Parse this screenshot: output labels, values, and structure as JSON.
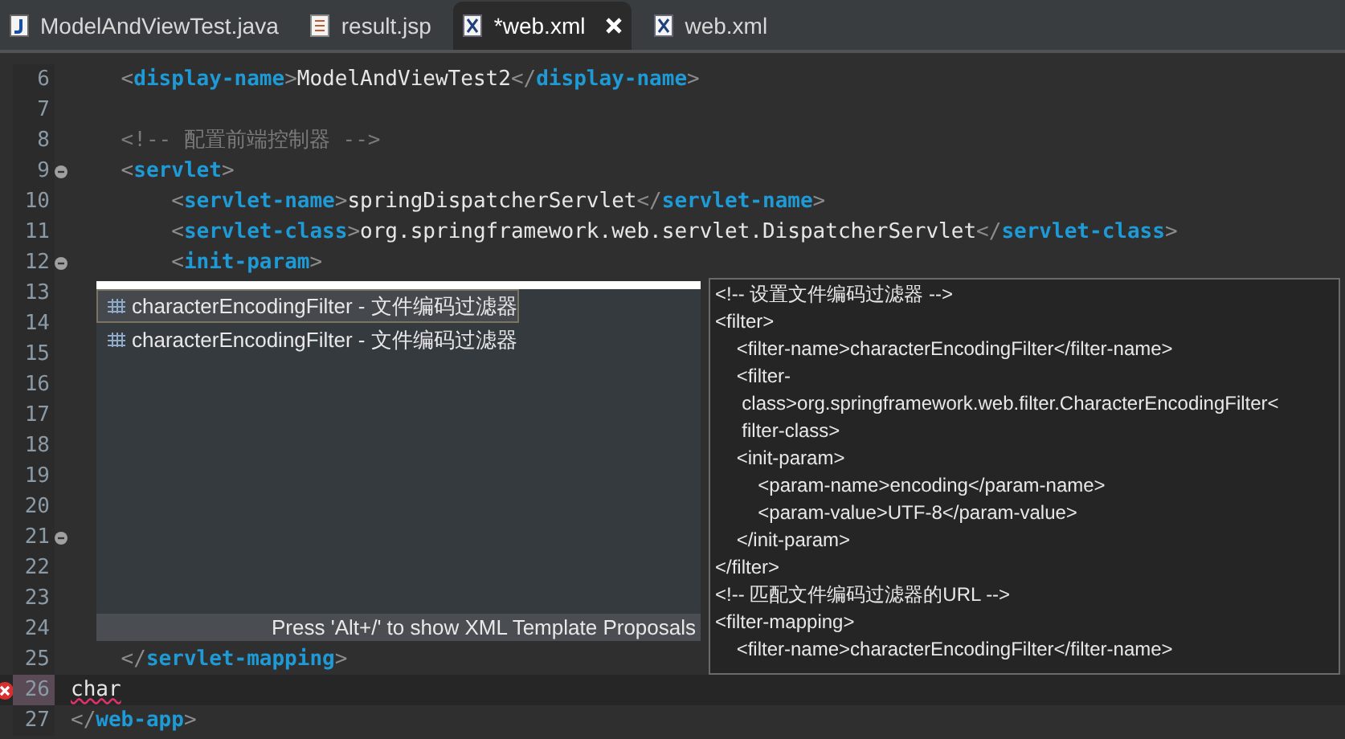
{
  "tabs": [
    {
      "label": "ModelAndViewTest.java",
      "kind": "java",
      "selected": false
    },
    {
      "label": "result.jsp",
      "kind": "jsp",
      "selected": false
    },
    {
      "label": "*web.xml",
      "kind": "xml",
      "selected": true
    },
    {
      "label": "web.xml",
      "kind": "xml",
      "selected": false
    }
  ],
  "editor": {
    "lines": [
      {
        "number": "6",
        "tokens": [
          {
            "kind": "bracket",
            "text": "    <"
          },
          {
            "kind": "tag",
            "text": "display-name"
          },
          {
            "kind": "bracket",
            "text": ">"
          },
          {
            "kind": "text",
            "text": "ModelAndViewTest2"
          },
          {
            "kind": "bracket",
            "text": "</"
          },
          {
            "kind": "tag",
            "text": "display-name"
          },
          {
            "kind": "bracket",
            "text": ">"
          }
        ]
      },
      {
        "number": "7"
      },
      {
        "number": "8",
        "tokens": [
          {
            "kind": "comment",
            "text": "    <!-- 配置前端控制器 -->"
          }
        ]
      },
      {
        "number": "9",
        "folding": true,
        "tokens": [
          {
            "kind": "bracket",
            "text": "    <"
          },
          {
            "kind": "tag",
            "text": "servlet"
          },
          {
            "kind": "bracket",
            "text": ">"
          }
        ]
      },
      {
        "number": "10",
        "tokens": [
          {
            "kind": "bracket",
            "text": "        <"
          },
          {
            "kind": "tag",
            "text": "servlet-name"
          },
          {
            "kind": "bracket",
            "text": ">"
          },
          {
            "kind": "text",
            "text": "springDispatcherServlet"
          },
          {
            "kind": "bracket",
            "text": "</"
          },
          {
            "kind": "tag",
            "text": "servlet-name"
          },
          {
            "kind": "bracket",
            "text": ">"
          }
        ]
      },
      {
        "number": "11",
        "tokens": [
          {
            "kind": "bracket",
            "text": "        <"
          },
          {
            "kind": "tag",
            "text": "servlet-class"
          },
          {
            "kind": "bracket",
            "text": ">"
          },
          {
            "kind": "text",
            "text": "org.springframework.web.servlet.DispatcherServlet"
          },
          {
            "kind": "bracket",
            "text": "</"
          },
          {
            "kind": "tag",
            "text": "servlet-class"
          },
          {
            "kind": "bracket",
            "text": ">"
          }
        ]
      },
      {
        "number": "12",
        "folding": true,
        "tokens": [
          {
            "kind": "bracket",
            "text": "        <"
          },
          {
            "kind": "tag",
            "text": "init-param"
          },
          {
            "kind": "bracket",
            "text": ">"
          }
        ]
      },
      {
        "number": "13"
      },
      {
        "number": "14"
      },
      {
        "number": "15"
      },
      {
        "number": "16"
      },
      {
        "number": "17"
      },
      {
        "number": "18"
      },
      {
        "number": "19"
      },
      {
        "number": "20"
      },
      {
        "number": "21",
        "folding": true
      },
      {
        "number": "22"
      },
      {
        "number": "23"
      },
      {
        "number": "24"
      },
      {
        "number": "25",
        "tokens": [
          {
            "kind": "bracket",
            "text": "    </"
          },
          {
            "kind": "tag",
            "text": "servlet-mapping"
          },
          {
            "kind": "bracket",
            "text": ">"
          }
        ]
      },
      {
        "number": "26",
        "current": true,
        "error": true,
        "tokens": [
          {
            "kind": "text",
            "text": "char"
          }
        ]
      },
      {
        "number": "27",
        "tokens": [
          {
            "kind": "bracket",
            "text": "</"
          },
          {
            "kind": "tag",
            "text": "web-app"
          },
          {
            "kind": "bracket",
            "text": ">"
          }
        ]
      }
    ]
  },
  "completion": {
    "items": [
      {
        "label": "characterEncodingFilter - 文件编码过滤器",
        "selected": true
      },
      {
        "label": "characterEncodingFilter - 文件编码过滤器",
        "selected": false
      }
    ],
    "status": "Press 'Alt+/' to show XML Template Proposals"
  },
  "preview": {
    "lines": [
      "<!-- 设置文件编码过滤器 -->",
      "<filter>",
      "    <filter-name>characterEncodingFilter</filter-name>",
      "    <filter-",
      "     class>org.springframework.web.filter.CharacterEncodingFilter<",
      "     filter-class>",
      "    <init-param>",
      "        <param-name>encoding</param-name>",
      "        <param-value>UTF-8</param-value>",
      "    </init-param>",
      "</filter>",
      "<!-- 匹配文件编码过滤器的URL -->",
      "<filter-mapping>",
      "    <filter-name>characterEncodingFilter</filter-name>"
    ]
  }
}
